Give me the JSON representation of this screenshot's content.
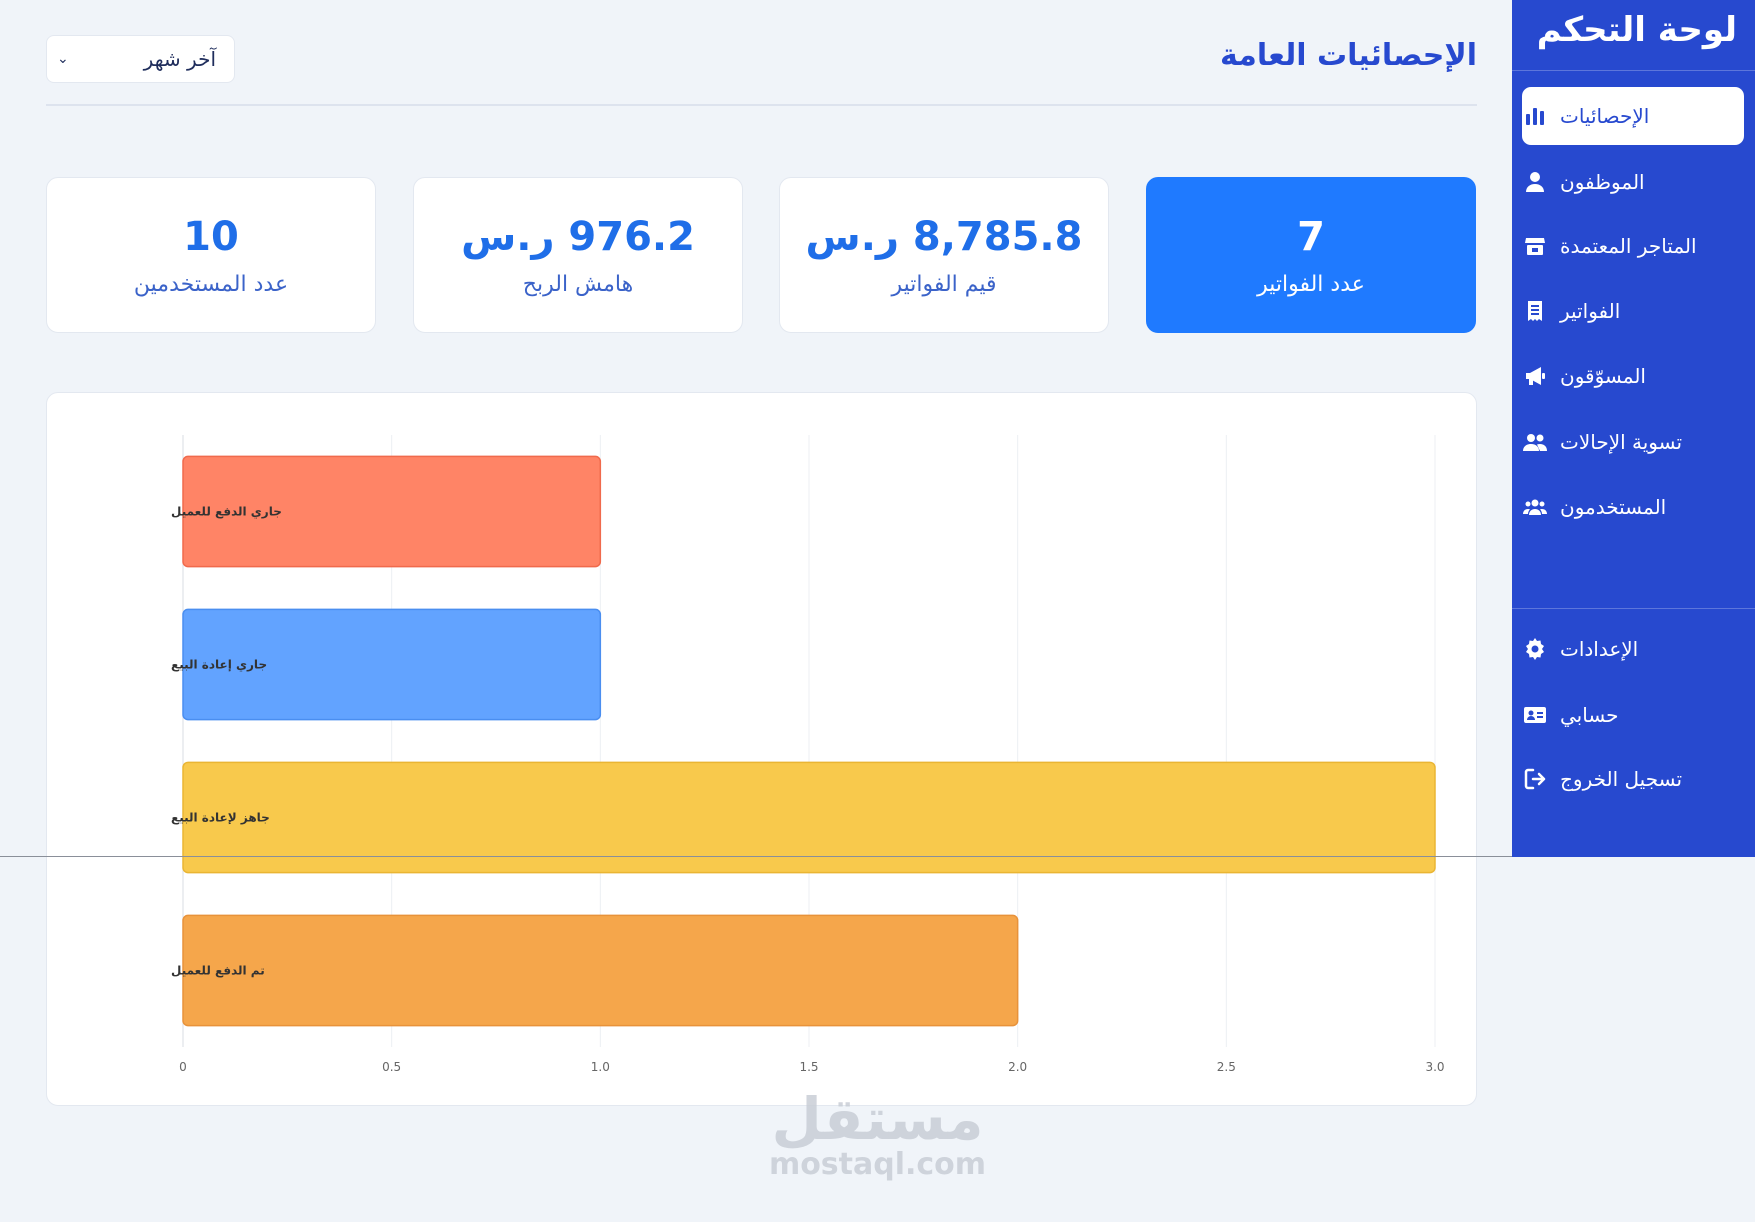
{
  "sidebar": {
    "title": "لوحة التحكم",
    "items": [
      {
        "label": "الإحصائيات",
        "icon": "bar-chart-icon",
        "active": true
      },
      {
        "label": "الموظفون",
        "icon": "user-icon"
      },
      {
        "label": "المتاجر المعتمدة",
        "icon": "store-icon"
      },
      {
        "label": "الفواتير",
        "icon": "receipt-icon"
      },
      {
        "label": "المسوّقون",
        "icon": "megaphone-icon"
      },
      {
        "label": "تسوية الإحالات",
        "icon": "users-icon"
      },
      {
        "label": "المستخدمون",
        "icon": "users-group-icon"
      }
    ],
    "bottom_items": [
      {
        "label": "الإعدادات",
        "icon": "gear-icon"
      },
      {
        "label": "حسابي",
        "icon": "id-card-icon"
      },
      {
        "label": "تسجيل الخروج",
        "icon": "logout-icon"
      }
    ]
  },
  "header": {
    "title": "الإحصائيات العامة",
    "period_select": "آخر شهر"
  },
  "stats": [
    {
      "value": "7",
      "label": "عدد الفواتير"
    },
    {
      "value": "8,785.8 ر.س",
      "label": "قيم الفواتير"
    },
    {
      "value": "976.2 ر.س",
      "label": "هامش الربح"
    },
    {
      "value": "10",
      "label": "عدد المستخدمين"
    }
  ],
  "colors": {
    "sidebar_bg": "#2749cf",
    "primary_card": "#1f7aff",
    "bar_red": "#ff8466",
    "bar_blue": "#62a3ff",
    "bar_yellow": "#f8c94c",
    "bar_orange": "#f5a64b"
  },
  "chart_data": {
    "type": "bar",
    "orientation": "horizontal",
    "categories": [
      "جاري الدفع للعميل",
      "جاري إعادة البيع",
      "جاهز لإعادة البيع",
      "تم الدفع للعميل"
    ],
    "values": [
      1,
      1,
      3,
      2
    ],
    "bar_colors": [
      "#ff8466",
      "#62a3ff",
      "#f8c94c",
      "#f5a64b"
    ],
    "bar_borders": [
      "#f06a4c",
      "#4a8ef0",
      "#eab533",
      "#e8923a"
    ],
    "xlim": [
      0,
      3
    ],
    "xticks": [
      "0",
      "0.5",
      "1.0",
      "1.5",
      "2.0",
      "2.5",
      "3.0"
    ],
    "grid": true
  },
  "watermark": {
    "arabic": "مستقل",
    "english": "mostaql.com"
  }
}
